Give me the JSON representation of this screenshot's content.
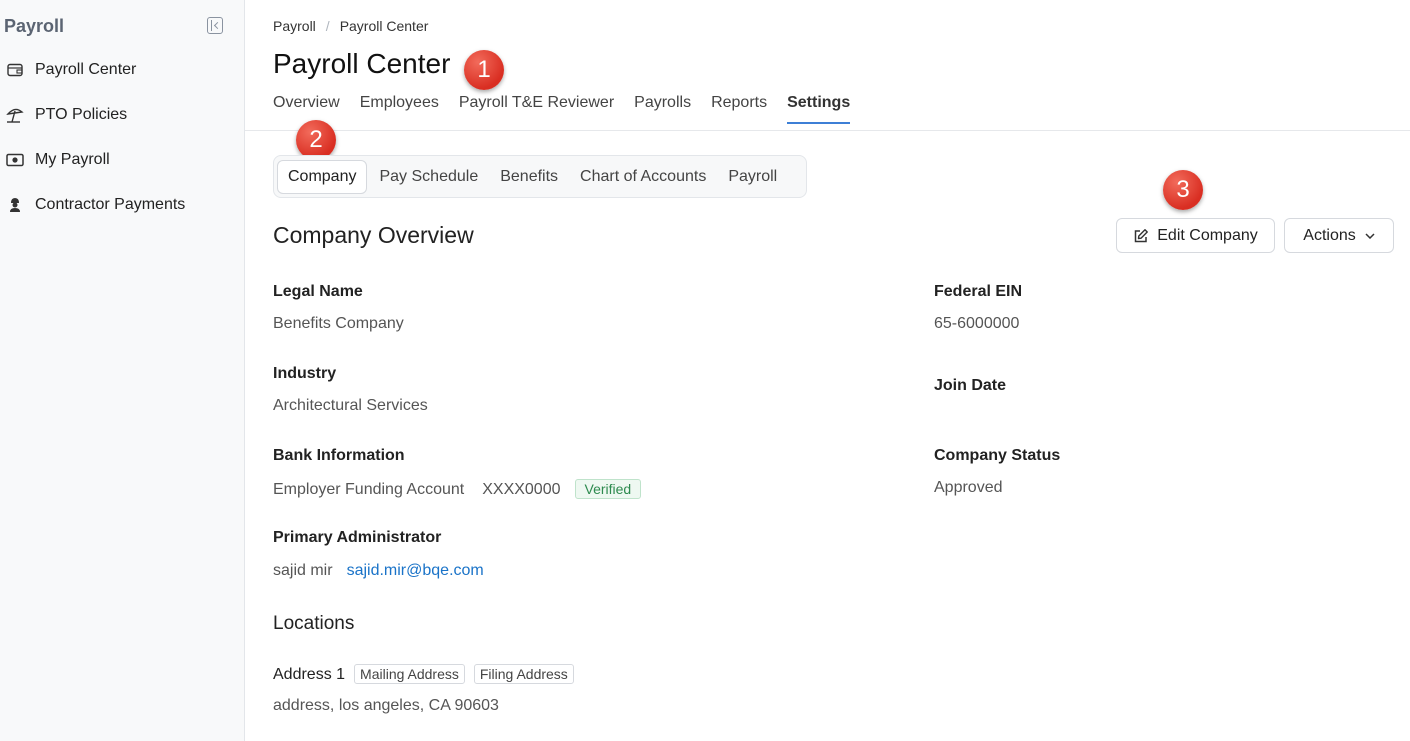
{
  "sidebar": {
    "title": "Payroll",
    "items": [
      {
        "label": "Payroll Center",
        "icon": "wallet-icon"
      },
      {
        "label": "PTO Policies",
        "icon": "umbrella-beach-icon"
      },
      {
        "label": "My Payroll",
        "icon": "cash-icon"
      },
      {
        "label": "Contractor Payments",
        "icon": "contractor-icon"
      }
    ]
  },
  "breadcrumb": [
    "Payroll",
    "Payroll Center"
  ],
  "page_title": "Payroll Center",
  "annotations": [
    "1",
    "2",
    "3"
  ],
  "tabs": [
    "Overview",
    "Employees",
    "Payroll T&E Reviewer",
    "Payrolls",
    "Reports",
    "Settings"
  ],
  "active_tab": "Settings",
  "subtabs": [
    "Company",
    "Pay Schedule",
    "Benefits",
    "Chart of Accounts",
    "Payroll"
  ],
  "active_subtab": "Company",
  "section_title": "Company Overview",
  "buttons": {
    "edit_company": "Edit Company",
    "actions": "Actions"
  },
  "fields": {
    "legal_name": {
      "label": "Legal Name",
      "value": "Benefits Company"
    },
    "federal_ein": {
      "label": "Federal EIN",
      "value": "65-6000000"
    },
    "industry": {
      "label": "Industry",
      "value": "Architectural Services"
    },
    "join_date": {
      "label": "Join Date",
      "value": ""
    },
    "bank": {
      "label": "Bank Information",
      "account": "Employer Funding Account",
      "number": "XXXX0000",
      "status": "Verified"
    },
    "company_status": {
      "label": "Company Status",
      "value": "Approved"
    },
    "primary_admin": {
      "label": "Primary Administrator",
      "name": "sajid mir",
      "email": "sajid.mir@bqe.com"
    }
  },
  "locations": {
    "title": "Locations",
    "address_label": "Address 1",
    "tags": [
      "Mailing Address",
      "Filing Address"
    ],
    "address": "address, los angeles, CA 90603"
  },
  "colors": {
    "accent": "#3d7fd6",
    "annotation": "#d92e22",
    "verified": "#2d8a4e",
    "link": "#1a73c8"
  }
}
